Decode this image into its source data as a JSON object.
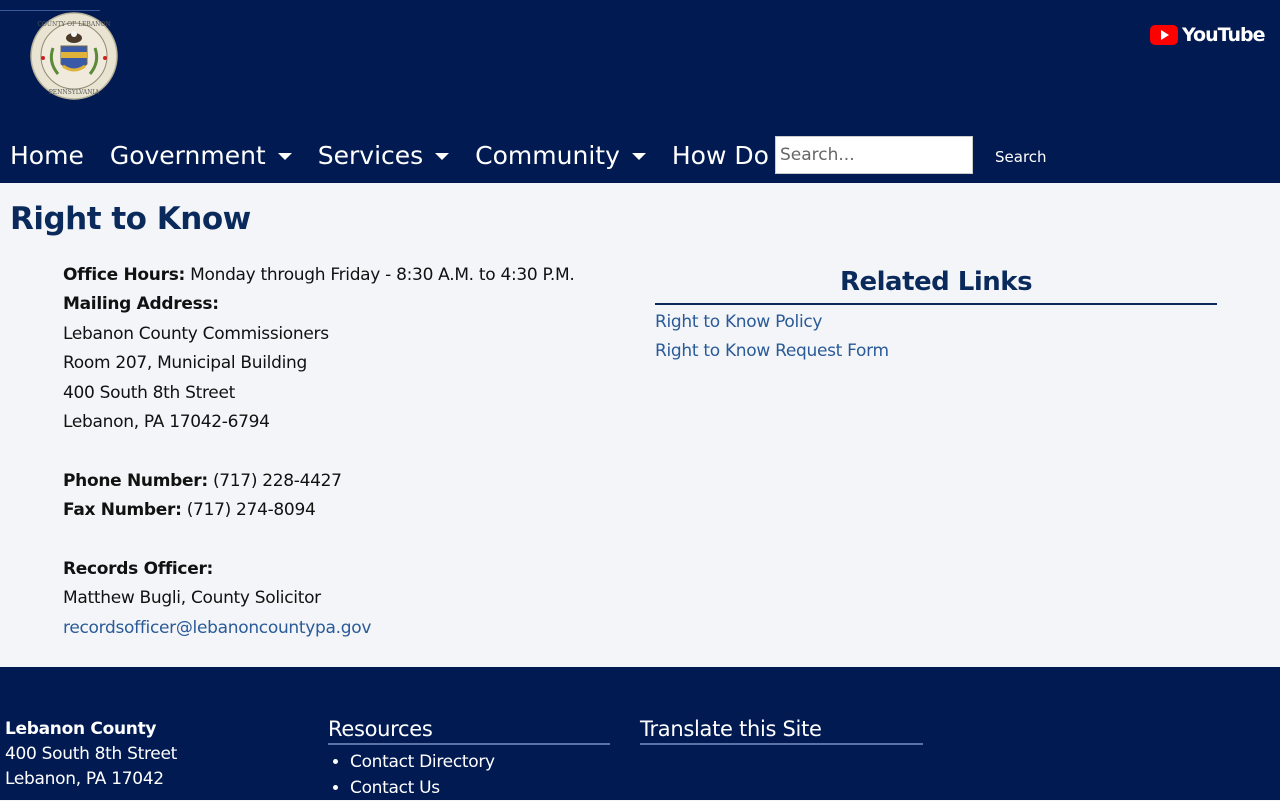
{
  "header": {
    "seal_alt": "County of Lebanon Pennsylvania seal",
    "youtube_label": "YouTube"
  },
  "nav": {
    "items": [
      {
        "label": "Home",
        "dropdown": false
      },
      {
        "label": "Government",
        "dropdown": true
      },
      {
        "label": "Services",
        "dropdown": true
      },
      {
        "label": "Community",
        "dropdown": true
      },
      {
        "label": "How Do I",
        "dropdown": true
      }
    ],
    "search_placeholder": "Search...",
    "search_button": "Search"
  },
  "page": {
    "title": "Right to Know",
    "office_hours_label": "Office Hours:",
    "office_hours_value": "Monday through Friday - 8:30 A.M. to 4:30 P.M.",
    "mailing_label": "Mailing Address:",
    "mailing_lines": [
      "Lebanon County Commissioners",
      "Room 207, Municipal Building",
      "400 South 8th Street",
      "Lebanon, PA 17042-6794"
    ],
    "phone_label": "Phone Number:",
    "phone_value": "(717) 228-4427",
    "fax_label": "Fax Number:",
    "fax_value": "(717) 274-8094",
    "records_label": "Records Officer:",
    "records_name": "Matthew Bugli, County Solicitor",
    "records_email": "recordsofficer@lebanoncountypa.gov"
  },
  "related": {
    "title": "Related Links",
    "links": [
      "Right to Know Policy",
      "Right to Know Request Form"
    ]
  },
  "footer": {
    "org_name": "Lebanon County",
    "addr_lines": [
      "400 South 8th Street",
      "Lebanon, PA 17042"
    ],
    "resources_title": "Resources",
    "resources_links": [
      "Contact Directory",
      "Contact Us"
    ],
    "translate_title": "Translate this Site"
  },
  "colors": {
    "navy": "#011a52",
    "title_blue": "#0b2a5c",
    "link_blue": "#2a5a98",
    "youtube_red": "#ff0000"
  }
}
